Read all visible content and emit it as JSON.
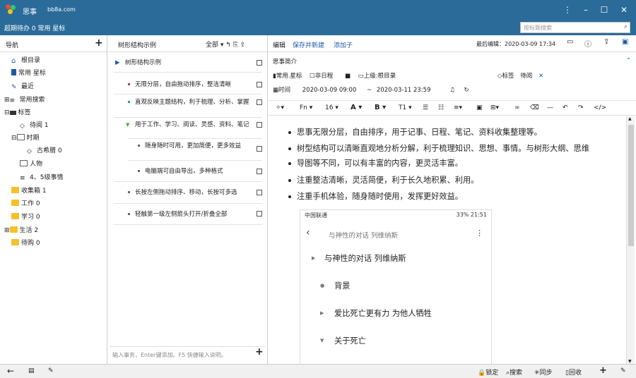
{
  "app": {
    "title": "思事",
    "url": "bb8a.com"
  },
  "subbar": {
    "text": "超期待办 0  常用 星标",
    "search_placeholder": "按标题搜索"
  },
  "nav": {
    "title": "导航",
    "items": [
      {
        "label": "根目录",
        "icon": "home-icon"
      },
      {
        "label": "常用 星标",
        "icon": "bookmark-icon"
      },
      {
        "label": "最近",
        "icon": "edit-icon"
      },
      {
        "label": "常用搜索",
        "icon": "search-list-icon"
      },
      {
        "label": "标签",
        "icon": "tag-icon"
      },
      {
        "label": "待阅 1",
        "icon": "tag-outline-icon"
      },
      {
        "label": "时期",
        "icon": "calendar-icon"
      },
      {
        "label": "古希腊 0",
        "icon": "tag-outline-icon"
      },
      {
        "label": "人物",
        "icon": "calendar-icon"
      },
      {
        "label": "4、5级事情",
        "icon": "search-list-icon"
      },
      {
        "label": "收集箱 1",
        "icon": "folder-icon"
      },
      {
        "label": "工作 0",
        "icon": "folder-icon"
      },
      {
        "label": "学习 0",
        "icon": "folder-icon"
      },
      {
        "label": "生活 2",
        "icon": "folder-icon"
      },
      {
        "label": "待购 0",
        "icon": "folder-icon"
      }
    ]
  },
  "mid": {
    "title": "树形结构示例",
    "filter": "全部",
    "items": [
      {
        "text": "树形结构示例"
      },
      {
        "text": "无限分层，自由拖动排序，整洁清晰"
      },
      {
        "text": "直观反映主题结构，利于梳理、分析、掌握"
      },
      {
        "text": "用于工作、学习、阅读、灵感、资料、笔记"
      },
      {
        "text": "随身随时可用，更加简便，更多效益"
      },
      {
        "text": "电脑端可自由导出，多种格式"
      },
      {
        "text": "长按左侧拖动排序、移动，长按可多选"
      },
      {
        "text": "轻触第一级左侧箭头打开/折叠全部"
      }
    ],
    "input_placeholder": "输入事务，Enter键添加。F5 快捷输入说明。"
  },
  "editor": {
    "edit": "编辑",
    "save_new": "保存并新建",
    "add_child": "添加子",
    "last_edit": "最后编辑：2020-03-09 17:34",
    "title": "思事简介",
    "star": "常用.星标",
    "non_schedule": "非日程",
    "parent": "上级:根目录",
    "tag_label": "标签",
    "tag_value": "待阅",
    "time_label": "时间",
    "time_start": "2020-03-09 09:00",
    "time_sep": "~",
    "time_end": "2020-03-11 23:59",
    "toolbar": {
      "font": "Fn",
      "size": "16",
      "bold": "B",
      "format": "T1"
    },
    "bullets": [
      "思事无限分层，自由排序，用于记事、日程、笔记、资料收集整理等。",
      "树型结构可以清晰直观地分析分解，利于梳理知识、思想、事情。与树形大纲、思维",
      "导图等不同，可以有丰富的内容，更灵活丰富。",
      "注重整洁清晰，灵活简便，利于长久地积累、利用。",
      "注重手机体验，随身随时使用，发挥更好效益。"
    ],
    "phone": {
      "carrier": "中国联通",
      "status": "33% 21:51",
      "header": "与神性的对话 列维纳斯",
      "rows": [
        "与神性的对话 列维纳斯",
        "背景",
        "爱比死亡更有力 为他人牺牲",
        "关于死亡"
      ]
    }
  },
  "status": {
    "lock": "锁定",
    "search": "搜索",
    "sync": "同步",
    "recycle": "回收"
  },
  "colors": {
    "titlebar": "#2a6b99",
    "link": "#1e5aa8",
    "folder": "#f5c12a"
  }
}
